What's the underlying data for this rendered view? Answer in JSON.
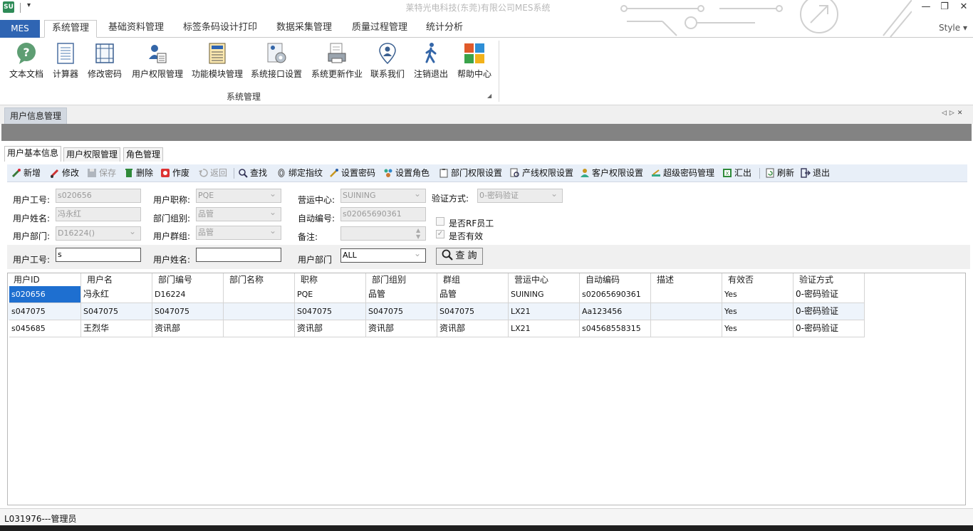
{
  "window": {
    "title": "莱特光电科技(东莞)有限公司MES系统",
    "logo": "SU",
    "qa_arrow": "▾"
  },
  "ribbon": {
    "app_button": "MES",
    "tabs": [
      "系统管理",
      "基础资料管理",
      "标签条码设计打印",
      "数据采集管理",
      "质量过程管理",
      "统计分析"
    ],
    "active_tab": "系统管理",
    "style_menu": "Style ▾",
    "group_label": "系统管理",
    "buttons": [
      {
        "label": "文本文档",
        "icon": "help-bubble-icon"
      },
      {
        "label": "计算器",
        "icon": "calculator-icon"
      },
      {
        "label": "修改密码",
        "icon": "grid-form-icon"
      },
      {
        "label": "用户权限管理",
        "icon": "user-permission-icon"
      },
      {
        "label": "功能模块管理",
        "icon": "module-list-icon"
      },
      {
        "label": "系统接口设置",
        "icon": "interface-gear-icon"
      },
      {
        "label": "系统更新作业",
        "icon": "update-printer-icon"
      },
      {
        "label": "联系我们",
        "icon": "contact-pin-icon"
      },
      {
        "label": "注销退出",
        "icon": "walking-man-icon"
      },
      {
        "label": "帮助中心",
        "icon": "color-tiles-icon"
      }
    ]
  },
  "document_tab": "用户信息管理",
  "doc_nav": "◁▷✕",
  "inner_tabs": [
    "用户基本信息",
    "用户权限管理",
    "角色管理"
  ],
  "toolbar": [
    {
      "label": "新增",
      "icon": "pencil-add-icon",
      "enabled": true
    },
    {
      "label": "修改",
      "icon": "pencil-edit-icon",
      "enabled": true
    },
    {
      "label": "保存",
      "icon": "save-icon",
      "enabled": false
    },
    {
      "label": "删除",
      "icon": "trash-icon",
      "enabled": true
    },
    {
      "label": "作废",
      "icon": "void-icon",
      "enabled": true
    },
    {
      "label": "返回",
      "icon": "undo-icon",
      "enabled": false
    },
    {
      "label": "查找",
      "icon": "search-icon",
      "enabled": true
    },
    {
      "label": "绑定指纹",
      "icon": "fingerprint-icon",
      "enabled": true
    },
    {
      "label": "设置密码",
      "icon": "key-icon",
      "enabled": true
    },
    {
      "label": "设置角色",
      "icon": "roles-icon",
      "enabled": true
    },
    {
      "label": "部门权限设置",
      "icon": "clipboard-icon",
      "enabled": true
    },
    {
      "label": "产线权限设置",
      "icon": "doc-search-icon",
      "enabled": true
    },
    {
      "label": "客户权限设置",
      "icon": "customer-icon",
      "enabled": true
    },
    {
      "label": "超级密码管理",
      "icon": "super-key-icon",
      "enabled": true
    },
    {
      "label": "汇出",
      "icon": "export-icon",
      "enabled": true
    },
    {
      "label": "刷新",
      "icon": "refresh-icon",
      "enabled": true
    },
    {
      "label": "退出",
      "icon": "exit-icon",
      "enabled": true
    }
  ],
  "form": {
    "user_id": {
      "label": "用户工号:",
      "value": "s020656"
    },
    "user_name": {
      "label": "用户姓名:",
      "value": "冯永红"
    },
    "user_dept": {
      "label": "用户部门:",
      "value": "D16224()"
    },
    "title": {
      "label": "用户职称:",
      "value": "PQE"
    },
    "dept_group": {
      "label": "部门组别:",
      "value": "品管"
    },
    "user_group": {
      "label": "用户群组:",
      "value": "品管"
    },
    "ops_center": {
      "label": "营运中心:",
      "value": "SUINING"
    },
    "auto_code": {
      "label": "自动编号:",
      "value": "s02065690361"
    },
    "remark": {
      "label": "备注:",
      "value": ""
    },
    "auth_method": {
      "label": "验证方式:",
      "value": "0-密码验证"
    },
    "rf_employee": {
      "label": "是否RF员工",
      "checked": false
    },
    "is_valid": {
      "label": "是否有效",
      "checked": true
    }
  },
  "search": {
    "user_id_label": "用户工号:",
    "user_id_value": "s",
    "user_name_label": "用户姓名:",
    "user_name_value": "",
    "dept_label": "用户部门",
    "dept_value": "ALL",
    "query_button": "查 詢"
  },
  "grid": {
    "columns": [
      "用户ID",
      "用户名",
      "部门编号",
      "部门名称",
      "职称",
      "部门组别",
      "群组",
      "营运中心",
      "自动编码",
      "描述",
      "有效否",
      "验证方式"
    ],
    "rows": [
      [
        "s020656",
        "冯永红",
        "D16224",
        "",
        "PQE",
        "品管",
        "品管",
        "SUINING",
        "s02065690361",
        "",
        "Yes",
        "0-密码验证"
      ],
      [
        "s047075",
        "S047075",
        "S047075",
        "",
        "S047075",
        "S047075",
        "S047075",
        "LX21",
        "Aa123456",
        "",
        "Yes",
        "0-密码验证"
      ],
      [
        "s045685",
        "王烈华",
        "资讯部",
        "",
        "资讯部",
        "资讯部",
        "资讯部",
        "LX21",
        "s04568558315",
        "",
        "Yes",
        "0-密码验证"
      ]
    ]
  },
  "status": "L031976---管理员"
}
